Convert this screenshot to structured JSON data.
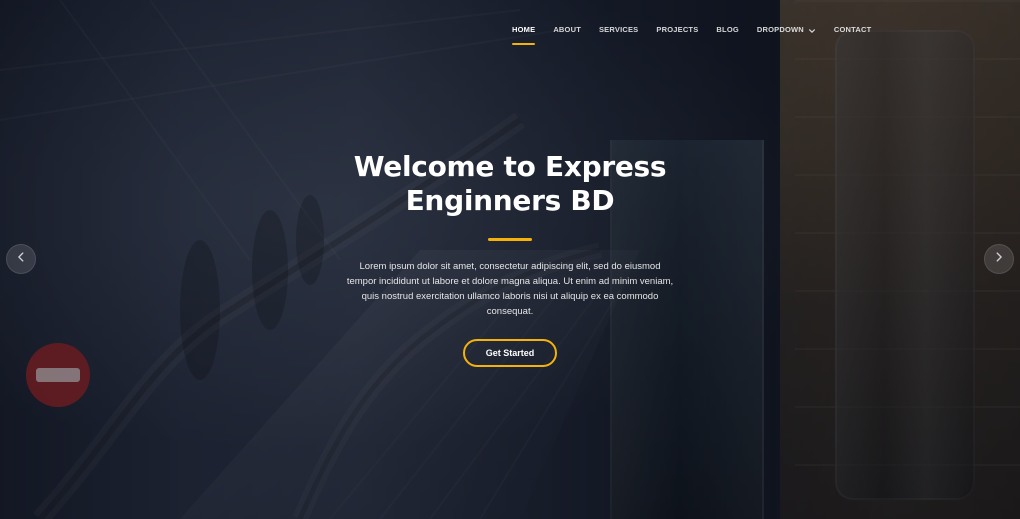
{
  "nav": {
    "items": [
      {
        "label": "HOME",
        "active": true
      },
      {
        "label": "ABOUT",
        "active": false
      },
      {
        "label": "SERVICES",
        "active": false
      },
      {
        "label": "PROJECTS",
        "active": false
      },
      {
        "label": "BLOG",
        "active": false
      },
      {
        "label": "DROPDOWN",
        "active": false,
        "has_dropdown": true
      },
      {
        "label": "CONTACT",
        "active": false
      }
    ]
  },
  "hero": {
    "title": "Welcome to Express Enginners BD",
    "description": "Lorem ipsum dolor sit amet, consectetur adipiscing elit, sed do eiusmod tempor incididunt ut labore et dolore magna aliqua. Ut enim ad minim veniam, quis nostrud exercitation ullamco laboris nisi ut aliquip ex ea commodo consequat.",
    "cta_label": "Get Started"
  },
  "slider": {
    "prev_icon": "chevron-left-icon",
    "next_icon": "chevron-right-icon"
  },
  "colors": {
    "accent": "#f5b20b",
    "text": "#ffffff"
  }
}
